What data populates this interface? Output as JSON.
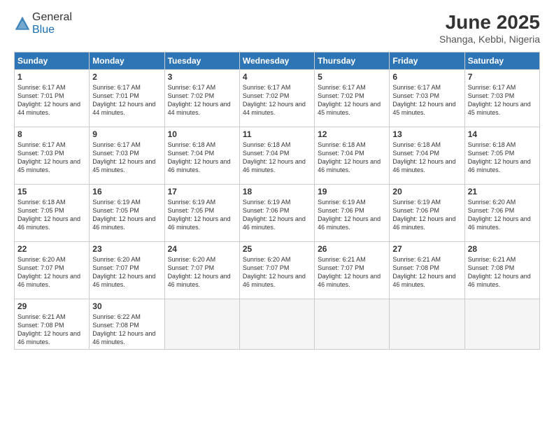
{
  "header": {
    "logo_general": "General",
    "logo_blue": "Blue",
    "month_title": "June 2025",
    "location": "Shanga, Kebbi, Nigeria"
  },
  "weekdays": [
    "Sunday",
    "Monday",
    "Tuesday",
    "Wednesday",
    "Thursday",
    "Friday",
    "Saturday"
  ],
  "weeks": [
    [
      {
        "day": "1",
        "sunrise": "6:17 AM",
        "sunset": "7:01 PM",
        "daylight": "12 hours and 44 minutes."
      },
      {
        "day": "2",
        "sunrise": "6:17 AM",
        "sunset": "7:01 PM",
        "daylight": "12 hours and 44 minutes."
      },
      {
        "day": "3",
        "sunrise": "6:17 AM",
        "sunset": "7:02 PM",
        "daylight": "12 hours and 44 minutes."
      },
      {
        "day": "4",
        "sunrise": "6:17 AM",
        "sunset": "7:02 PM",
        "daylight": "12 hours and 44 minutes."
      },
      {
        "day": "5",
        "sunrise": "6:17 AM",
        "sunset": "7:02 PM",
        "daylight": "12 hours and 45 minutes."
      },
      {
        "day": "6",
        "sunrise": "6:17 AM",
        "sunset": "7:03 PM",
        "daylight": "12 hours and 45 minutes."
      },
      {
        "day": "7",
        "sunrise": "6:17 AM",
        "sunset": "7:03 PM",
        "daylight": "12 hours and 45 minutes."
      }
    ],
    [
      {
        "day": "8",
        "sunrise": "6:17 AM",
        "sunset": "7:03 PM",
        "daylight": "12 hours and 45 minutes."
      },
      {
        "day": "9",
        "sunrise": "6:17 AM",
        "sunset": "7:03 PM",
        "daylight": "12 hours and 45 minutes."
      },
      {
        "day": "10",
        "sunrise": "6:18 AM",
        "sunset": "7:04 PM",
        "daylight": "12 hours and 46 minutes."
      },
      {
        "day": "11",
        "sunrise": "6:18 AM",
        "sunset": "7:04 PM",
        "daylight": "12 hours and 46 minutes."
      },
      {
        "day": "12",
        "sunrise": "6:18 AM",
        "sunset": "7:04 PM",
        "daylight": "12 hours and 46 minutes."
      },
      {
        "day": "13",
        "sunrise": "6:18 AM",
        "sunset": "7:04 PM",
        "daylight": "12 hours and 46 minutes."
      },
      {
        "day": "14",
        "sunrise": "6:18 AM",
        "sunset": "7:05 PM",
        "daylight": "12 hours and 46 minutes."
      }
    ],
    [
      {
        "day": "15",
        "sunrise": "6:18 AM",
        "sunset": "7:05 PM",
        "daylight": "12 hours and 46 minutes."
      },
      {
        "day": "16",
        "sunrise": "6:19 AM",
        "sunset": "7:05 PM",
        "daylight": "12 hours and 46 minutes."
      },
      {
        "day": "17",
        "sunrise": "6:19 AM",
        "sunset": "7:05 PM",
        "daylight": "12 hours and 46 minutes."
      },
      {
        "day": "18",
        "sunrise": "6:19 AM",
        "sunset": "7:06 PM",
        "daylight": "12 hours and 46 minutes."
      },
      {
        "day": "19",
        "sunrise": "6:19 AM",
        "sunset": "7:06 PM",
        "daylight": "12 hours and 46 minutes."
      },
      {
        "day": "20",
        "sunrise": "6:19 AM",
        "sunset": "7:06 PM",
        "daylight": "12 hours and 46 minutes."
      },
      {
        "day": "21",
        "sunrise": "6:20 AM",
        "sunset": "7:06 PM",
        "daylight": "12 hours and 46 minutes."
      }
    ],
    [
      {
        "day": "22",
        "sunrise": "6:20 AM",
        "sunset": "7:07 PM",
        "daylight": "12 hours and 46 minutes."
      },
      {
        "day": "23",
        "sunrise": "6:20 AM",
        "sunset": "7:07 PM",
        "daylight": "12 hours and 46 minutes."
      },
      {
        "day": "24",
        "sunrise": "6:20 AM",
        "sunset": "7:07 PM",
        "daylight": "12 hours and 46 minutes."
      },
      {
        "day": "25",
        "sunrise": "6:20 AM",
        "sunset": "7:07 PM",
        "daylight": "12 hours and 46 minutes."
      },
      {
        "day": "26",
        "sunrise": "6:21 AM",
        "sunset": "7:07 PM",
        "daylight": "12 hours and 46 minutes."
      },
      {
        "day": "27",
        "sunrise": "6:21 AM",
        "sunset": "7:08 PM",
        "daylight": "12 hours and 46 minutes."
      },
      {
        "day": "28",
        "sunrise": "6:21 AM",
        "sunset": "7:08 PM",
        "daylight": "12 hours and 46 minutes."
      }
    ],
    [
      {
        "day": "29",
        "sunrise": "6:21 AM",
        "sunset": "7:08 PM",
        "daylight": "12 hours and 46 minutes."
      },
      {
        "day": "30",
        "sunrise": "6:22 AM",
        "sunset": "7:08 PM",
        "daylight": "12 hours and 46 minutes."
      },
      null,
      null,
      null,
      null,
      null
    ]
  ],
  "labels": {
    "sunrise": "Sunrise:",
    "sunset": "Sunset:",
    "daylight": "Daylight:"
  }
}
